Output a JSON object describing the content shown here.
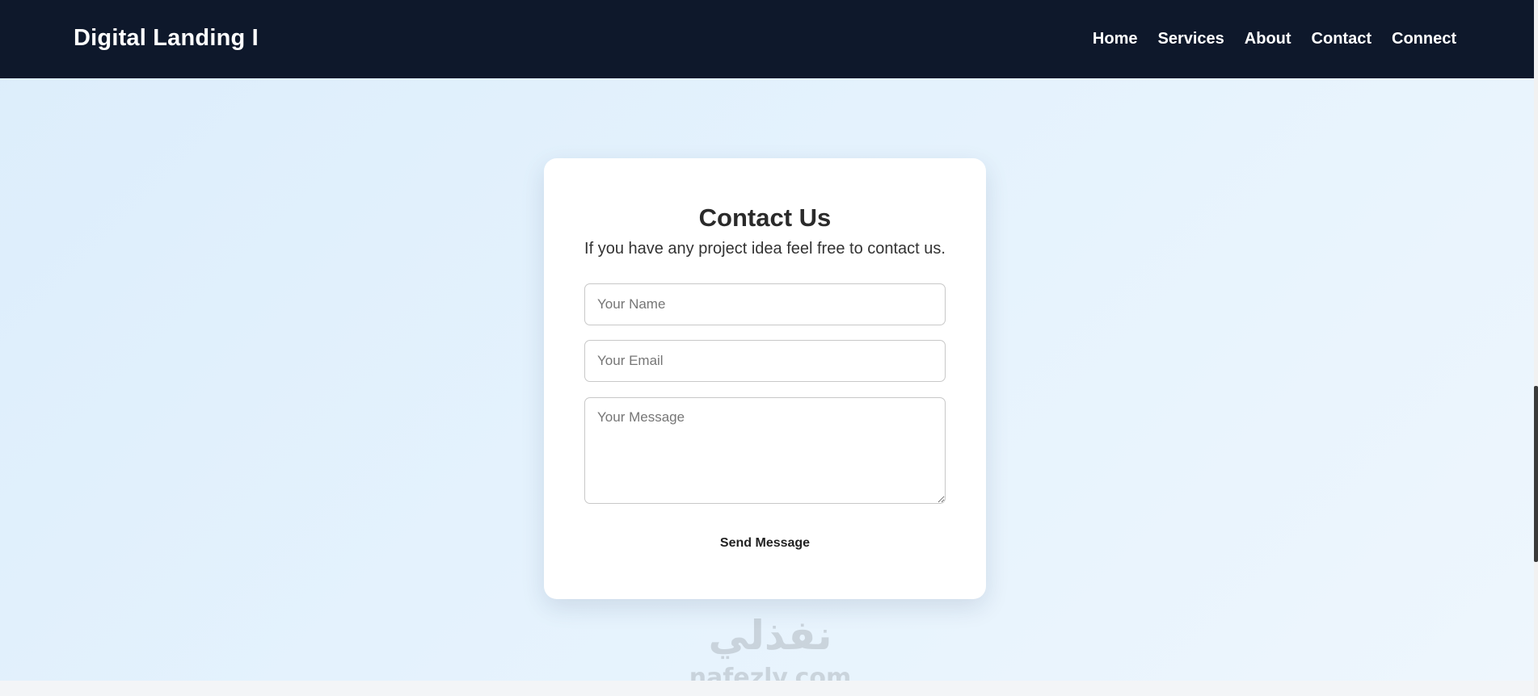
{
  "header": {
    "brand": "Digital Landing I",
    "nav": [
      "Home",
      "Services",
      "About",
      "Contact",
      "Connect"
    ]
  },
  "contact": {
    "title": "Contact Us",
    "subtitle": "If you have any project idea feel free to contact us.",
    "name_placeholder": "Your Name",
    "email_placeholder": "Your Email",
    "message_placeholder": "Your Message",
    "submit_label": "Send Message"
  },
  "watermark": {
    "arabic": "نفذلي",
    "latin": "nafezly.com"
  },
  "colors": {
    "navbar": "#0e182b",
    "card": "#ffffff",
    "background": "#e4f2fd"
  }
}
